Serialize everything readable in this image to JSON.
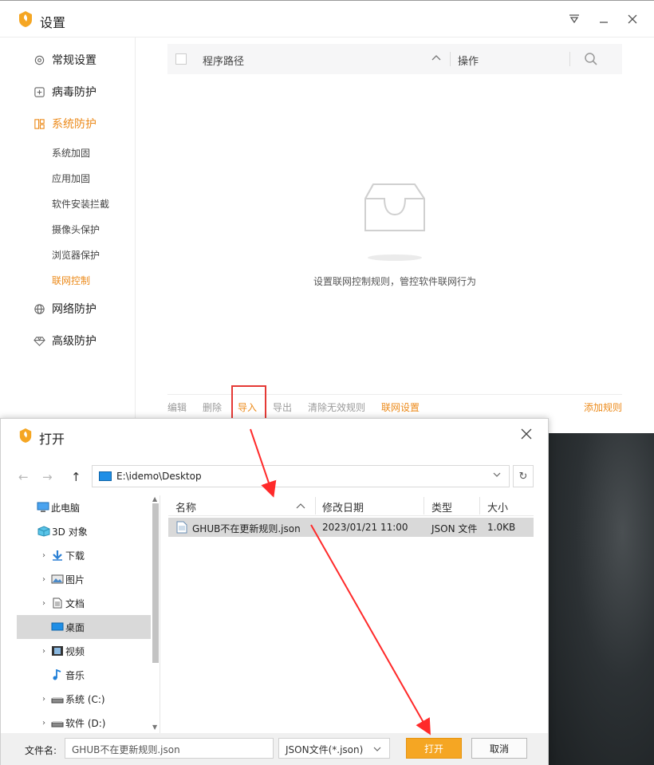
{
  "settings": {
    "title": "设置",
    "sidebar": {
      "items": [
        {
          "label": "常规设置",
          "icon": "gear-icon"
        },
        {
          "label": "病毒防护",
          "icon": "plus-box-icon"
        },
        {
          "label": "系统防护",
          "icon": "grid-icon"
        },
        {
          "label": "网络防护",
          "icon": "globe-icon"
        },
        {
          "label": "高级防护",
          "icon": "diamond-icon"
        }
      ],
      "subitems": [
        "系统加固",
        "应用加固",
        "软件安装拦截",
        "摄像头保护",
        "浏览器保护",
        "联网控制"
      ]
    },
    "table": {
      "col_path": "程序路径",
      "col_action": "操作"
    },
    "empty_text": "设置联网控制规则，管控软件联网行为",
    "footer": {
      "edit": "编辑",
      "delete": "删除",
      "import": "导入",
      "export": "导出",
      "clear": "清除无效规则",
      "net_settings": "联网设置",
      "add_rule": "添加规则"
    },
    "accent_color": "#ec8a1a"
  },
  "dialog": {
    "title": "打开",
    "address": "E:\\idemo\\Desktop",
    "tree": [
      {
        "label": "此电脑",
        "icon": "computer-icon",
        "expand": false
      },
      {
        "label": "3D 对象",
        "icon": "cube-icon",
        "expand": false
      },
      {
        "label": "下载",
        "icon": "download-icon",
        "expand": true
      },
      {
        "label": "图片",
        "icon": "picture-icon",
        "expand": true
      },
      {
        "label": "文档",
        "icon": "document-icon",
        "expand": true
      },
      {
        "label": "桌面",
        "icon": "desktop-icon",
        "expand": false
      },
      {
        "label": "视频",
        "icon": "video-icon",
        "expand": true
      },
      {
        "label": "音乐",
        "icon": "music-icon",
        "expand": false
      },
      {
        "label": "系统 (C:)",
        "icon": "drive-icon",
        "expand": true
      },
      {
        "label": "软件 (D:)",
        "icon": "drive-icon",
        "expand": true
      }
    ],
    "columns": {
      "name": "名称",
      "date": "修改日期",
      "type": "类型",
      "size": "大小"
    },
    "files": [
      {
        "name": "GHUB不在更新规则.json",
        "date": "2023/01/21 11:00",
        "type": "JSON 文件",
        "size": "1.0KB"
      }
    ],
    "filename_label": "文件名:",
    "filename_value": "GHUB不在更新规则.json",
    "filetype": "JSON文件(*.json)",
    "open_label": "打开",
    "cancel_label": "取消"
  }
}
